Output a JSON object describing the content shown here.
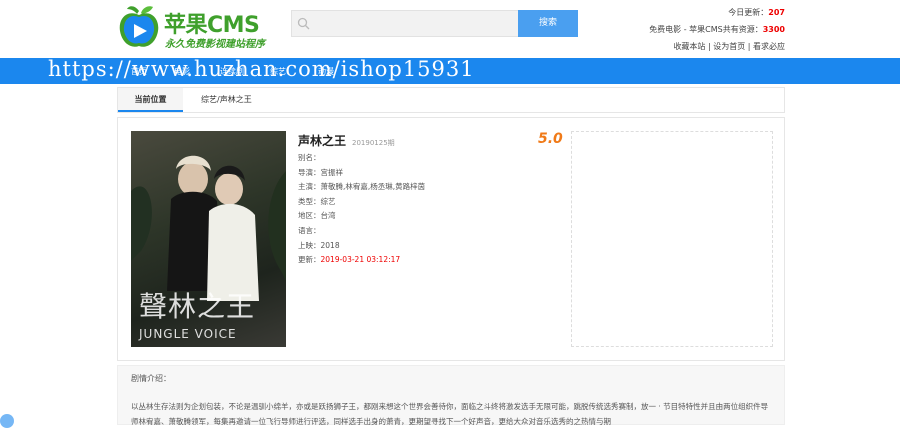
{
  "logo": {
    "text": "苹果CMS",
    "slogan": "永久免费影视建站程序",
    "icon": "apple-play-icon"
  },
  "search": {
    "placeholder": "",
    "button": "搜索"
  },
  "top_right": {
    "today_label": "今日更新：",
    "today_count": "207",
    "total_label": "免费电影 - 苹果CMS共有资源：",
    "total_count": "3300",
    "links": [
      "收藏本站",
      "设为首页",
      "看求必应"
    ]
  },
  "nav": {
    "items": [
      "首页",
      "电影",
      "连续剧",
      "综艺",
      "动漫"
    ]
  },
  "watermark": "https://www.huzhan.com/ishop15931",
  "breadcrumb": {
    "label": "当前位置",
    "path": "综艺/声林之王"
  },
  "detail": {
    "title": "声林之王",
    "episode": "20190125期",
    "score": "5.0",
    "rows": [
      {
        "label": "别名：",
        "value": ""
      },
      {
        "label": "导演：",
        "value": "宫振祥"
      },
      {
        "label": "主演：",
        "value": "萧敬腾,林宥嘉,杨丞琳,黄路梓茵"
      },
      {
        "label": "类型：",
        "value": "综艺"
      },
      {
        "label": "地区：",
        "value": "台湾"
      },
      {
        "label": "语言：",
        "value": ""
      },
      {
        "label": "上映：",
        "value": "2018"
      },
      {
        "label": "更新：",
        "value": "2019-03-21 03:12:17"
      }
    ],
    "poster_title": "聲林之王",
    "poster_sub": "JUNGLE VOICE"
  },
  "synopsis": {
    "label": "剧情介绍：",
    "text": "以丛林生存法则为企划包装，不论是温驯小绵羊，亦或是跃扬狮子王，都刚来想这个世界会善待你，面临之斗终将激发选手无限可能，跳脱传统选秀赛制，放一 · 节目特特性并且由两位组织件导师林宥嘉、萧敬腾领军，每集再邀请一位飞行导师进行评选，同样选手出身的萧青，更期望寻找下一个好声音，更给大众对音乐选秀的之热情与期"
  },
  "colors": {
    "accent": "#1b87ee",
    "brand_green": "#3fa02c",
    "score": "#f07a18",
    "red": "#ee0000"
  }
}
